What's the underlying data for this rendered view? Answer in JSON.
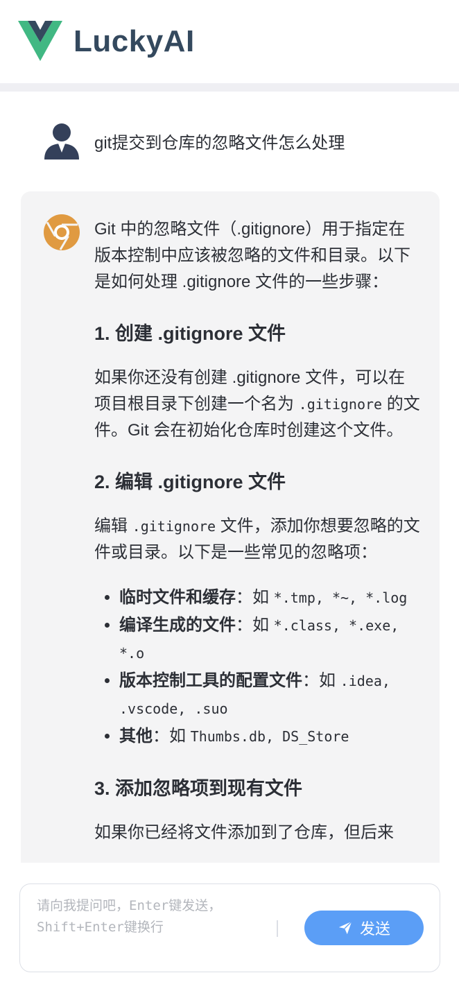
{
  "header": {
    "brand": "LuckyAI",
    "logo_icon": "vue-logo-icon",
    "brand_colors": {
      "outer": "#41b883",
      "inner": "#34495e"
    }
  },
  "conversation": {
    "user_message": "git提交到仓库的忽略文件怎么处理",
    "user_avatar_icon": "user-avatar-icon",
    "ai_avatar_icon": "chrome-style-avatar-icon",
    "ai_reply": {
      "intro": "Git 中的忽略文件（.gitignore）用于指定在版本控制中应该被忽略的文件和目录。以下是如何处理 .gitignore 文件的一些步骤：",
      "section1_title": "1. 创建 .gitignore 文件",
      "section1_text_a": "如果你还没有创建 .gitignore 文件，可以在项目根目录下创建一个名为 ",
      "section1_code": ".gitignore",
      "section1_text_b": " 的文件。Git 会在初始化仓库时创建这个文件。",
      "section2_title": "2. 编辑 .gitignore 文件",
      "section2_text_a": "编辑 ",
      "section2_code": ".gitignore",
      "section2_text_b": " 文件，添加你想要忽略的文件或目录。以下是一些常见的忽略项：",
      "items": [
        {
          "label": "临时文件和缓存",
          "sep": "：如 ",
          "codes": "*.tmp, *~, *.log"
        },
        {
          "label": "编译生成的文件",
          "sep": "：如 ",
          "codes": "*.class, *.exe, *.o"
        },
        {
          "label": "版本控制工具的配置文件",
          "sep": "：如 ",
          "codes": ".idea, .vscode, .suo"
        },
        {
          "label": "其他",
          "sep": "：如 ",
          "codes": "Thumbs.db, DS_Store"
        }
      ],
      "section3_title": "3. 添加忽略项到现有文件",
      "section3_text": "如果你已经将文件添加到了仓库，但后来"
    }
  },
  "composer": {
    "placeholder": "请向我提问吧，Enter键发送，Shift+Enter键换行",
    "send_label": "发送",
    "send_icon": "paper-plane-icon",
    "accent": "#5b9ef6"
  }
}
